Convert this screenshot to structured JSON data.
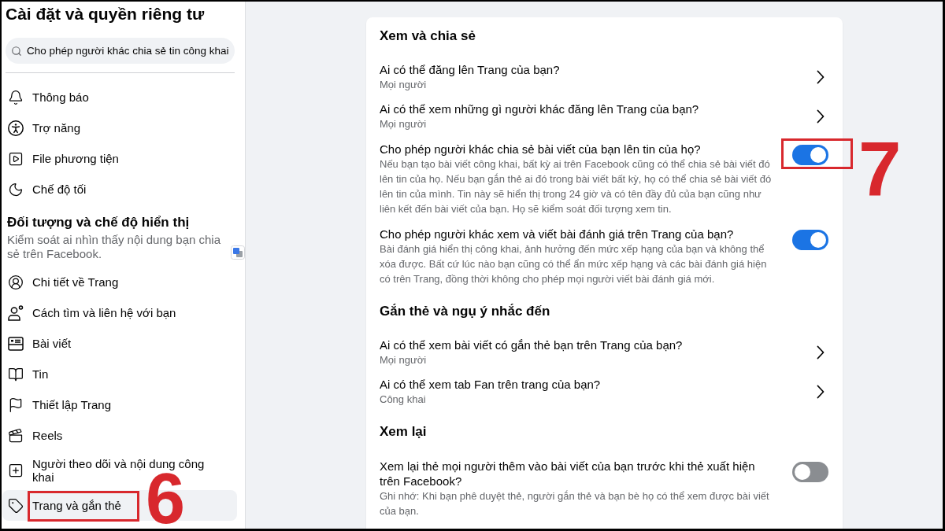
{
  "sidebar": {
    "title": "Cài đặt và quyền riêng tư",
    "search": {
      "value": "Cho phép người khác chia sẻ tin công khai"
    },
    "items": [
      {
        "label": "Thông báo",
        "selected": false
      },
      {
        "label": "Trợ năng",
        "selected": false
      },
      {
        "label": "File phương tiện",
        "selected": false
      },
      {
        "label": "Chế độ tối",
        "selected": false
      }
    ],
    "section": {
      "heading": "Đối tượng và chế độ hiển thị",
      "description": "Kiểm soát ai nhìn thấy nội dung bạn chia sẻ trên Facebook.",
      "items": [
        {
          "label": "Chi tiết về Trang",
          "selected": false
        },
        {
          "label": "Cách tìm và liên hệ với bạn",
          "selected": false
        },
        {
          "label": "Bài viết",
          "selected": false
        },
        {
          "label": "Tin",
          "selected": false
        },
        {
          "label": "Thiết lập Trang",
          "selected": false
        },
        {
          "label": "Reels",
          "selected": false
        },
        {
          "label": "Người theo dõi và nội dung công khai",
          "selected": false
        },
        {
          "label": "Trang và gắn thẻ",
          "selected": true,
          "callout": "6"
        }
      ]
    }
  },
  "settings": {
    "groups": [
      {
        "heading": "Xem và chia sẻ",
        "rows": [
          {
            "kind": "link",
            "title": "Ai có thể đăng lên Trang của bạn?",
            "value": "Mọi người"
          },
          {
            "kind": "link",
            "title": "Ai có thể xem những gì người khác đăng lên Trang của bạn?",
            "value": "Mọi người"
          },
          {
            "kind": "toggle",
            "title": "Cho phép người khác chia sẻ bài viết của bạn lên tin của họ?",
            "description": "Nếu bạn tạo bài viết công khai, bất kỳ ai trên Facebook cũng có thể chia sẻ bài viết đó lên tin của họ. Nếu bạn gắn thẻ ai đó trong bài viết bất kỳ, họ có thể chia sẻ bài viết đó lên tin của mình. Tin này sẽ hiển thị trong 24 giờ và có tên đầy đủ của bạn cũng như liên kết đến bài viết của bạn. Họ sẽ kiểm soát đối tượng xem tin.",
            "on": true,
            "callout": "7"
          },
          {
            "kind": "toggle",
            "title": "Cho phép người khác xem và viết bài đánh giá trên Trang của bạn?",
            "description": "Bài đánh giá hiển thị công khai, ảnh hưởng đến mức xếp hạng của bạn và không thể xóa được. Bất cứ lúc nào bạn cũng có thể ẩn mức xếp hạng và các bài đánh giá hiện có trên Trang, đồng thời không cho phép mọi người viết bài đánh giá mới.",
            "on": true
          }
        ]
      },
      {
        "heading": "Gắn thẻ và ngụ ý nhắc đến",
        "rows": [
          {
            "kind": "link",
            "title": "Ai có thể xem bài viết có gắn thẻ bạn trên Trang của bạn?",
            "value": "Mọi người"
          },
          {
            "kind": "link",
            "title": "Ai có thể xem tab Fan trên trang của bạn?",
            "value": "Công khai"
          }
        ]
      },
      {
        "heading": "Xem lại",
        "rows": [
          {
            "kind": "toggle",
            "title": "Xem lại thẻ mọi người thêm vào bài viết của bạn trước khi thẻ xuất hiện trên Facebook?",
            "description": "Ghi nhớ: Khi bạn phê duyệt thẻ, người gắn thẻ và bạn bè họ có thể xem được bài viết của bạn.",
            "on": false
          }
        ]
      }
    ]
  }
}
